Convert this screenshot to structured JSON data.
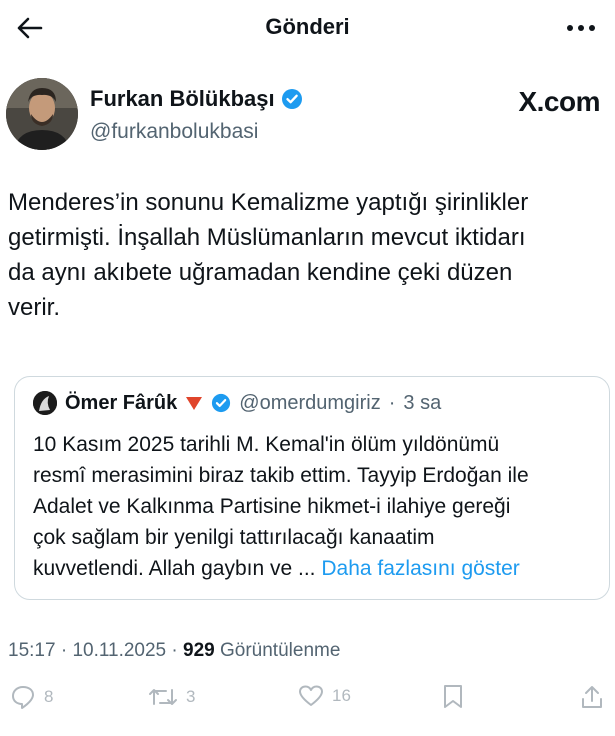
{
  "header": {
    "title": "Gönderi",
    "back_icon": "arrow-left-icon",
    "more_icon": "more-horizontal-icon"
  },
  "author": {
    "name": "Furkan Bölükbaşı",
    "handle": "@furkanbolukbasi",
    "verified": true,
    "watermark": "X.com"
  },
  "tweet": {
    "lines": [
      "Menderes’in sonunu Kemalizme yaptığı şirinlikler",
      "getirmişti. İnşallah Müslümanların mevcut iktidarı",
      "da aynı akıbete uğramadan kendine çeki düzen",
      "verir."
    ]
  },
  "quote": {
    "name": "Ömer Fârûk",
    "flag_icon": "red-triangle-icon",
    "verified": true,
    "handle": "@omerdumgiriz",
    "separator": "·",
    "time": "3 sa",
    "lines": [
      "10 Kasım 2025 tarihli M. Kemal'in ölüm yıldönümü",
      "resmî merasimini biraz takib ettim. Tayyip Erdoğan ile",
      "Adalet ve Kalkınma Partisine hikmet-i ilahiye gereği",
      "çok sağlam bir yenilgi tattırılacağı kanaatim",
      "kuvvetlendi. Allah gaybın ve ..."
    ],
    "show_more": "Daha fazlasını göster"
  },
  "meta": {
    "time": "15:17",
    "sep1": " · ",
    "date": "10.11.2025",
    "sep2": " · ",
    "views": "929",
    "views_label": " Görüntülenme"
  },
  "actions": {
    "reply_count": "8",
    "retweet_count": "3",
    "like_count": "16"
  },
  "colors": {
    "link": "#1d9bf0",
    "verified": "#1d9bf0",
    "secondary_text": "#536471",
    "border": "#cfd9de"
  }
}
